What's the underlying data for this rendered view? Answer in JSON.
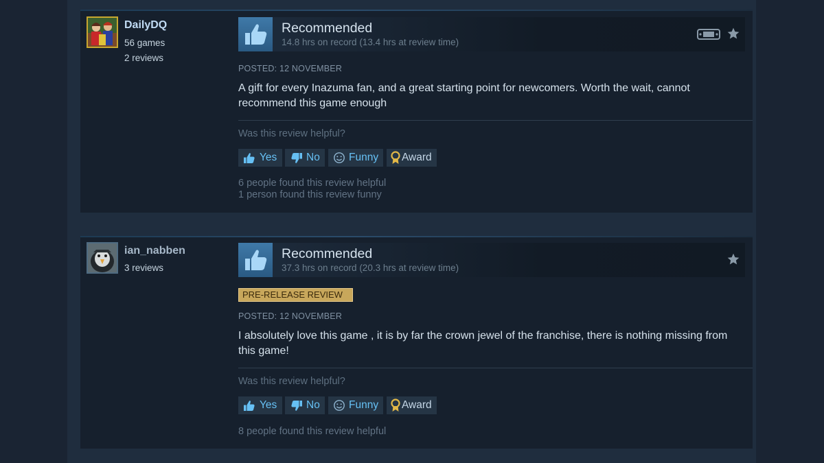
{
  "reviews": [
    {
      "author": {
        "name": "DailyDQ",
        "games": "56 games",
        "reviews": "2 reviews"
      },
      "verdict": "Recommended",
      "hours": "14.8 hrs on record (13.4 hrs at review time)",
      "badge": "",
      "posted": "POSTED: 12 NOVEMBER",
      "text": "A gift for every Inazuma fan, and a great starting point for newcomers. Worth the wait, cannot recommend this game enough",
      "helpful_question": "Was this review helpful?",
      "buttons": {
        "yes": "Yes",
        "no": "No",
        "funny": "Funny",
        "award": "Award"
      },
      "found_helpful": "6 people found this review helpful",
      "found_funny": "1 person found this review funny",
      "icons": [
        "steam-deck-icon",
        "star-icon"
      ]
    },
    {
      "author": {
        "name": "ian_nabben",
        "games": "",
        "reviews": "3 reviews"
      },
      "verdict": "Recommended",
      "hours": "37.3 hrs on record (20.3 hrs at review time)",
      "badge": "PRE-RELEASE REVIEW",
      "posted": "POSTED: 12 NOVEMBER",
      "text": "I absolutely love this game , it is by far the crown jewel of the franchise, there is nothing missing from this game!",
      "helpful_question": "Was this review helpful?",
      "buttons": {
        "yes": "Yes",
        "no": "No",
        "funny": "Funny",
        "award": "Award"
      },
      "found_helpful": "8 people found this review helpful",
      "found_funny": "",
      "icons": [
        "star-icon"
      ]
    }
  ],
  "colors": {
    "accent": "#66c0f4",
    "badge": "#c8a75b",
    "background": "#1b2838"
  }
}
